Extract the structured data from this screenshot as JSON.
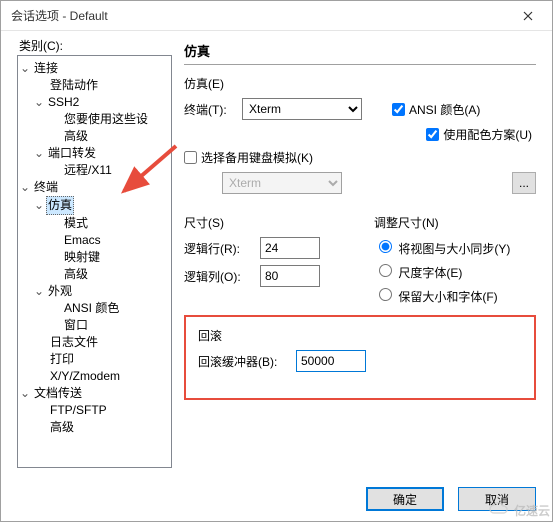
{
  "window": {
    "title": "会话选项 - Default"
  },
  "category_label": "类别(C):",
  "tree": {
    "n0": "连接",
    "n0_0": "登陆动作",
    "n0_1": "SSH2",
    "n0_1_0": "您要使用这些设",
    "n0_1_1": "高级",
    "n0_2": "端口转发",
    "n0_2_0": "远程/X11",
    "n1": "终端",
    "n1_0": "仿真",
    "n1_0_0": "模式",
    "n1_0_1": "Emacs",
    "n1_0_2": "映射键",
    "n1_0_3": "高级",
    "n1_1": "外观",
    "n1_1_0": "ANSI 颜色",
    "n1_1_1": "窗口",
    "n1_2": "日志文件",
    "n1_3": "打印",
    "n1_4": "X/Y/Zmodem",
    "n2": "文档传送",
    "n2_0": "FTP/SFTP",
    "n2_1": "高级"
  },
  "panel": {
    "title": "仿真",
    "emu_section": "仿真(E)",
    "terminal_label": "终端(T):",
    "terminal_value": "Xterm",
    "ansi_color": "ANSI 颜色(A)",
    "use_color_scheme": "使用配色方案(U)",
    "alt_keyboard": "选择备用键盘模拟(K)",
    "alt_keyboard_value": "Xterm",
    "ellipsis": "...",
    "size_section": "尺寸(S)",
    "logical_rows": "逻辑行(R):",
    "logical_rows_value": "24",
    "logical_cols": "逻辑列(O):",
    "logical_cols_value": "80",
    "resize_section": "调整尺寸(N)",
    "r1": "将视图与大小同步(Y)",
    "r2": "尺度字体(E)",
    "r3": "保留大小和字体(F)",
    "scroll_section": "回滚",
    "scroll_buffer": "回滚缓冲器(B):",
    "scroll_buffer_value": "50000"
  },
  "buttons": {
    "ok": "确定",
    "cancel": "取消"
  },
  "watermark": "亿速云"
}
